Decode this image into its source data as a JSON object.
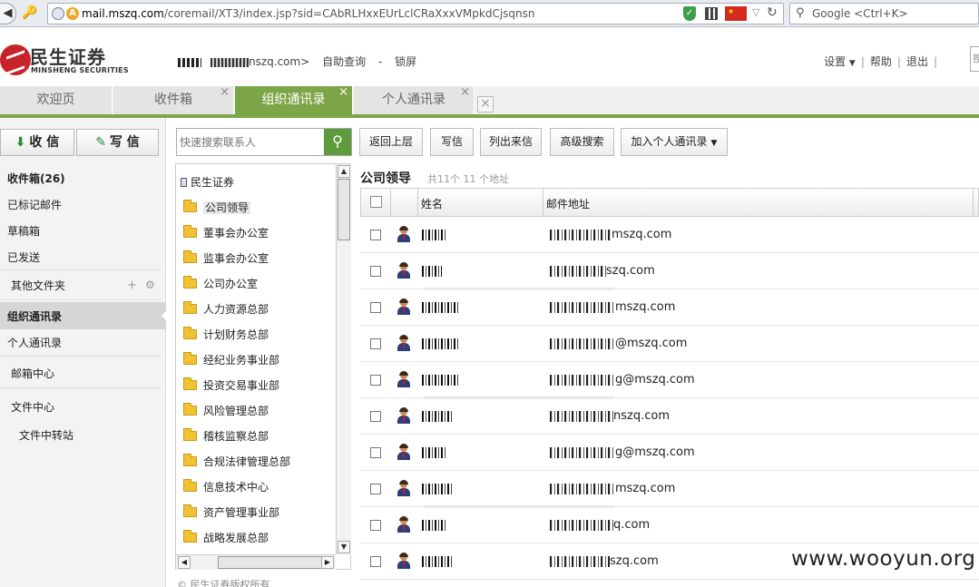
{
  "browser": {
    "url_host": "mail.mszq.com",
    "url_path": "/coremail/XT3/index.jsp?sid=CAbRLHxxEUrLclCRaXxxVMpkdCjsqnsn",
    "search_placeholder": "Google <Ctrl+K>"
  },
  "header": {
    "logo_cn": "民生证券",
    "logo_en": "MINSHENG SECURITIES",
    "user_domain": "nszq.com>",
    "self_help": "自助查询",
    "dash": "-",
    "lock": "锁屏",
    "settings": "设置",
    "help": "帮助",
    "logout": "退出",
    "search_cut": "搜"
  },
  "tabs": [
    {
      "label": "欢迎页"
    },
    {
      "label": "收件箱"
    },
    {
      "label": "组织通讯录"
    },
    {
      "label": "个人通讯录"
    }
  ],
  "nav": {
    "receive": "收 信",
    "compose": "写 信",
    "inbox": "收件箱(26)",
    "flagged": "已标记邮件",
    "drafts": "草稿箱",
    "sent": "已发送",
    "other": "其他文件夹",
    "org_contacts": "组织通讯录",
    "personal_contacts": "个人通讯录",
    "mailbox_center": "邮箱中心",
    "file_center": "文件中心",
    "file_transfer": "文件中转站"
  },
  "toolbar": {
    "search_placeholder": "快速搜索联系人",
    "up": "返回上层",
    "write": "写信",
    "list_from": "列出来信",
    "advanced": "高级搜索",
    "add_personal": "加入个人通讯录"
  },
  "tree": {
    "root": "民生证券",
    "folders": [
      "公司领导",
      "董事会办公室",
      "监事会办公室",
      "公司办公室",
      "人力资源总部",
      "计划财务总部",
      "经纪业务事业部",
      "投资交易事业部",
      "风险管理总部",
      "稽核监察总部",
      "合规法律管理总部",
      "信息技术中心",
      "资产管理事业部",
      "战略发展总部"
    ]
  },
  "list": {
    "title": "公司领导",
    "count": "共11个 11 个地址",
    "col_name": "姓名",
    "col_email": "邮件地址",
    "rows": [
      {
        "mail_suffix": "mszq.com"
      },
      {
        "mail_suffix": "szq.com"
      },
      {
        "mail_suffix": "mszq.com"
      },
      {
        "mail_suffix": "@mszq.com"
      },
      {
        "mail_suffix": "g@mszq.com"
      },
      {
        "mail_suffix": "nszq.com"
      },
      {
        "mail_suffix": "g@mszq.com"
      },
      {
        "mail_suffix": "mszq.com"
      },
      {
        "mail_suffix": "q.com"
      },
      {
        "mail_suffix": "szq.com"
      }
    ]
  },
  "footer": {
    "copyright": "© 民生证券版权所有"
  },
  "watermark": "www.wooyun.org",
  "colors": {
    "accent_green": "#7da648",
    "brand_red": "#c8232b"
  }
}
